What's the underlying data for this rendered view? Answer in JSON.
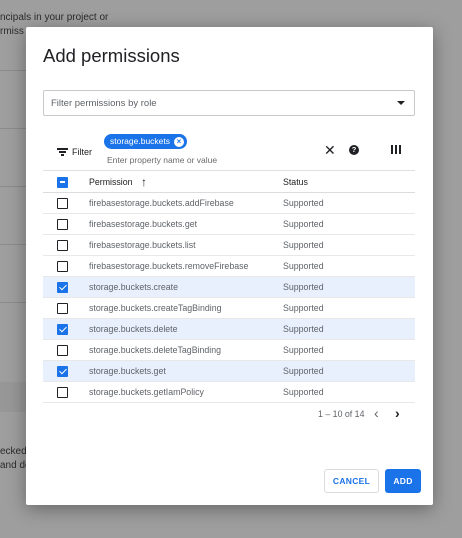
{
  "background": {
    "top_line1": "ncipals in your project or",
    "top_line2": "rmiss",
    "bottom_line1": "ecked",
    "bottom_line2": "and do"
  },
  "dialog": {
    "title": "Add permissions",
    "role_filter_placeholder": "Filter permissions by role",
    "filter": {
      "label": "Filter",
      "chip": "storage.buckets",
      "input_placeholder": "Enter property name or value"
    },
    "table": {
      "columns": {
        "permission": "Permission",
        "status": "Status"
      },
      "rows": [
        {
          "permission": "firebasestorage.buckets.addFirebase",
          "status": "Supported",
          "checked": false
        },
        {
          "permission": "firebasestorage.buckets.get",
          "status": "Supported",
          "checked": false
        },
        {
          "permission": "firebasestorage.buckets.list",
          "status": "Supported",
          "checked": false
        },
        {
          "permission": "firebasestorage.buckets.removeFirebase",
          "status": "Supported",
          "checked": false
        },
        {
          "permission": "storage.buckets.create",
          "status": "Supported",
          "checked": true
        },
        {
          "permission": "storage.buckets.createTagBinding",
          "status": "Supported",
          "checked": false
        },
        {
          "permission": "storage.buckets.delete",
          "status": "Supported",
          "checked": true
        },
        {
          "permission": "storage.buckets.deleteTagBinding",
          "status": "Supported",
          "checked": false
        },
        {
          "permission": "storage.buckets.get",
          "status": "Supported",
          "checked": true
        },
        {
          "permission": "storage.buckets.getIamPolicy",
          "status": "Supported",
          "checked": false
        }
      ]
    },
    "pagination": {
      "range": "1 – 10 of 14"
    },
    "actions": {
      "cancel": "CANCEL",
      "add": "ADD"
    }
  },
  "colors": {
    "accent": "#1a73e8",
    "selected_row": "#e8f0fe"
  }
}
